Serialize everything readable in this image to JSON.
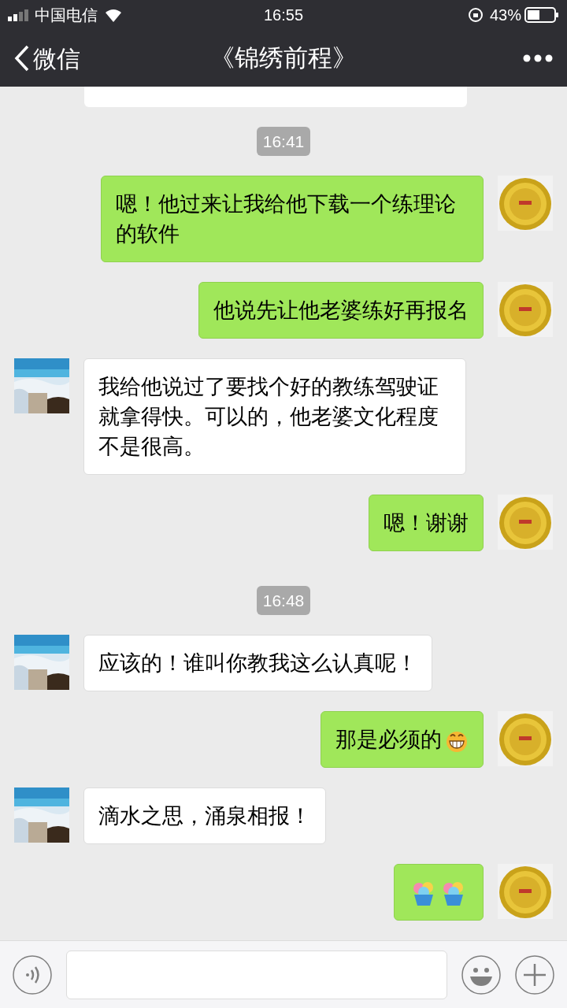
{
  "status_bar": {
    "carrier": "中国电信",
    "time": "16:55",
    "battery": "43%"
  },
  "nav": {
    "back": "微信",
    "title": "《锦绣前程》"
  },
  "messages": [
    {
      "kind": "partial",
      "sent": false
    },
    {
      "kind": "time",
      "text": "16:41"
    },
    {
      "kind": "message",
      "sent": true,
      "parts": [
        {
          "kind": "text",
          "text": "嗯！他过来让我给他下载一个练理论的软件"
        }
      ]
    },
    {
      "kind": "message",
      "sent": true,
      "parts": [
        {
          "kind": "text",
          "text": "他说先让他老婆练好再报名"
        }
      ]
    },
    {
      "kind": "message",
      "sent": false,
      "parts": [
        {
          "kind": "text",
          "text": "我给他说过了要找个好的教练驾驶证就拿得快。可以的，他老婆文化程度不是很高。"
        }
      ]
    },
    {
      "kind": "message",
      "sent": true,
      "parts": [
        {
          "kind": "text",
          "text": "嗯！谢谢"
        }
      ]
    },
    {
      "kind": "time",
      "text": "16:48"
    },
    {
      "kind": "message",
      "sent": false,
      "parts": [
        {
          "kind": "text",
          "text": "应该的！谁叫你教我这么认真呢！"
        }
      ]
    },
    {
      "kind": "message",
      "sent": true,
      "parts": [
        {
          "kind": "text",
          "text": "那是必须的"
        },
        {
          "kind": "grin"
        }
      ]
    },
    {
      "kind": "message",
      "sent": false,
      "parts": [
        {
          "kind": "text",
          "text": "滴水之思，涌泉相报！"
        }
      ]
    },
    {
      "kind": "message",
      "sent": true,
      "parts": [
        {
          "kind": "dessert"
        },
        {
          "kind": "dessert"
        }
      ]
    }
  ]
}
